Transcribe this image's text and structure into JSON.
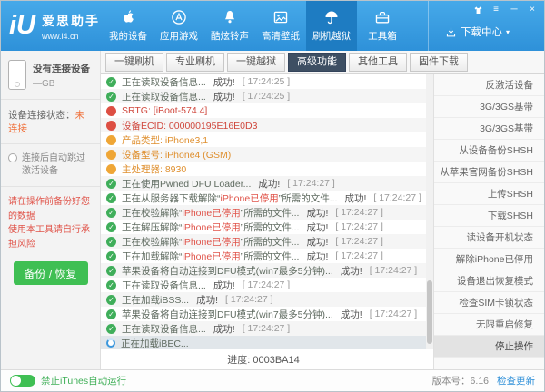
{
  "window": {
    "title": "爱思助手"
  },
  "header": {
    "logo_mark": "iU",
    "app_name": "爱思助手",
    "app_url": "www.i4.cn",
    "download_center": "下载中心",
    "nav_items": [
      {
        "label": "我的设备",
        "icon": "apple-icon",
        "active": false
      },
      {
        "label": "应用游戏",
        "icon": "appstore-icon",
        "active": false
      },
      {
        "label": "酷炫铃声",
        "icon": "bell-icon",
        "active": false
      },
      {
        "label": "高清壁纸",
        "icon": "wallpaper-icon",
        "active": false
      },
      {
        "label": "刷机越狱",
        "icon": "jailbreak-icon",
        "active": true
      },
      {
        "label": "工具箱",
        "icon": "toolbox-icon",
        "active": false
      }
    ],
    "window_controls": [
      "skin-icon",
      "menu-icon",
      "minimize-icon",
      "close-icon"
    ]
  },
  "tabs": [
    {
      "label": "一键刷机",
      "active": false
    },
    {
      "label": "专业刷机",
      "active": false
    },
    {
      "label": "一键越狱",
      "active": false
    },
    {
      "label": "高级功能",
      "active": true
    },
    {
      "label": "其他工具",
      "active": false
    },
    {
      "label": "固件下载",
      "active": false
    }
  ],
  "sidebar": {
    "device_name": "没有连接设备",
    "capacity": "—GB",
    "conn_status_label": "设备连接状态：",
    "conn_status_value": "未连接",
    "auto_option": "连接后自动跳过激活设备",
    "warning1": "请在操作前备份好您的数据",
    "warning2": "使用本工具请自行承担风险",
    "backup_button": "备份 / 恢复"
  },
  "log": {
    "progress": "进度: 0003BA14",
    "rows": [
      {
        "icon": "success",
        "text": "正在读取设备信息...",
        "status": "成功!",
        "time": "[ 17:24:25 ]"
      },
      {
        "icon": "success",
        "text": "正在读取设备信息...",
        "status": "成功!",
        "time": "[ 17:24:25 ]"
      },
      {
        "icon": "dot-red",
        "color": "red",
        "text": "SRTG: [iBoot-574.4]"
      },
      {
        "icon": "dot-red",
        "color": "red",
        "text": "设备ECID: 000000195E16E0D3"
      },
      {
        "icon": "dot-yellow",
        "color": "orange",
        "text": "产品类型: iPhone3,1"
      },
      {
        "icon": "dot-yellow",
        "color": "orange",
        "text": "设备型号: iPhone4 (GSM)"
      },
      {
        "icon": "dot-yellow",
        "color": "orange",
        "text": "主处理器: 8930"
      },
      {
        "icon": "success",
        "text": "正在使用Pwned DFU Loader...",
        "status": "成功!",
        "time": "[ 17:24:27 ]"
      },
      {
        "icon": "success",
        "text": "正在从服务器下载解除“iPhone已停用”所需的文件...",
        "em": "iPhone已停用",
        "status": "成功!",
        "time": "[ 17:24:27 ]"
      },
      {
        "icon": "success",
        "text": "正在校验解除“iPhone已停用”所需的文件...",
        "em": "iPhone已停用",
        "status": "成功!",
        "time": "[ 17:24:27 ]"
      },
      {
        "icon": "success",
        "text": "正在解压解除“iPhone已停用”所需的文件...",
        "em": "iPhone已停用",
        "status": "成功!",
        "time": "[ 17:24:27 ]"
      },
      {
        "icon": "success",
        "text": "正在校验解除“iPhone已停用”所需的文件...",
        "em": "iPhone已停用",
        "status": "成功!",
        "time": "[ 17:24:27 ]"
      },
      {
        "icon": "success",
        "text": "正在加载解除“iPhone已停用”所需的文件...",
        "em": "iPhone已停用",
        "status": "成功!",
        "time": "[ 17:24:27 ]"
      },
      {
        "icon": "success",
        "text": "苹果设备将自动连接到DFU模式(win7最多5分钟)...",
        "status": "成功!",
        "time": "[ 17:24:27 ]"
      },
      {
        "icon": "success",
        "text": "正在读取设备信息...",
        "status": "成功!",
        "time": "[ 17:24:27 ]"
      },
      {
        "icon": "success",
        "text": "正在加载iBSS...",
        "status": "成功!",
        "time": "[ 17:24:27 ]"
      },
      {
        "icon": "success",
        "text": "苹果设备将自动连接到DFU模式(win7最多5分钟)...",
        "status": "成功!",
        "time": "[ 17:24:27 ]"
      },
      {
        "icon": "success",
        "text": "正在读取设备信息...",
        "status": "成功!",
        "time": "[ 17:24:27 ]"
      },
      {
        "icon": "loading",
        "text": "正在加载iBEC...",
        "selected": true
      }
    ]
  },
  "right_panel": {
    "items": [
      {
        "label": "反激活设备",
        "active": false
      },
      {
        "label": "3G/3GS基带",
        "active": false
      },
      {
        "label": "3G/3GS基带",
        "active": false
      },
      {
        "label": "从设备备份SHSH",
        "active": false
      },
      {
        "label": "从苹果官网备份SHSH",
        "active": false
      },
      {
        "label": "上传SHSH",
        "active": false
      },
      {
        "label": "下载SHSH",
        "active": false
      },
      {
        "label": "读设备开机状态",
        "active": false
      },
      {
        "label": "解除iPhone已停用",
        "active": false
      },
      {
        "label": "设备退出恢复模式",
        "active": false
      },
      {
        "label": "检查SIM卡锁状态",
        "active": false
      },
      {
        "label": "无限重启修复",
        "active": false
      },
      {
        "label": "停止操作",
        "active": true
      }
    ]
  },
  "footer": {
    "itunes_block_label": "禁止iTunes自动运行",
    "version_label": "版本号：6.16",
    "check_update": "检查更新"
  },
  "colors": {
    "topbar_blue": "#2e91d9",
    "active_nav_blue": "#1e7cc2",
    "active_tab_slate": "#3e4f63",
    "success_green": "#3fae5a",
    "button_green": "#3fbf53",
    "warning_red": "#e0544a",
    "info_orange": "#efa636",
    "link_blue": "#2e8fd8"
  }
}
